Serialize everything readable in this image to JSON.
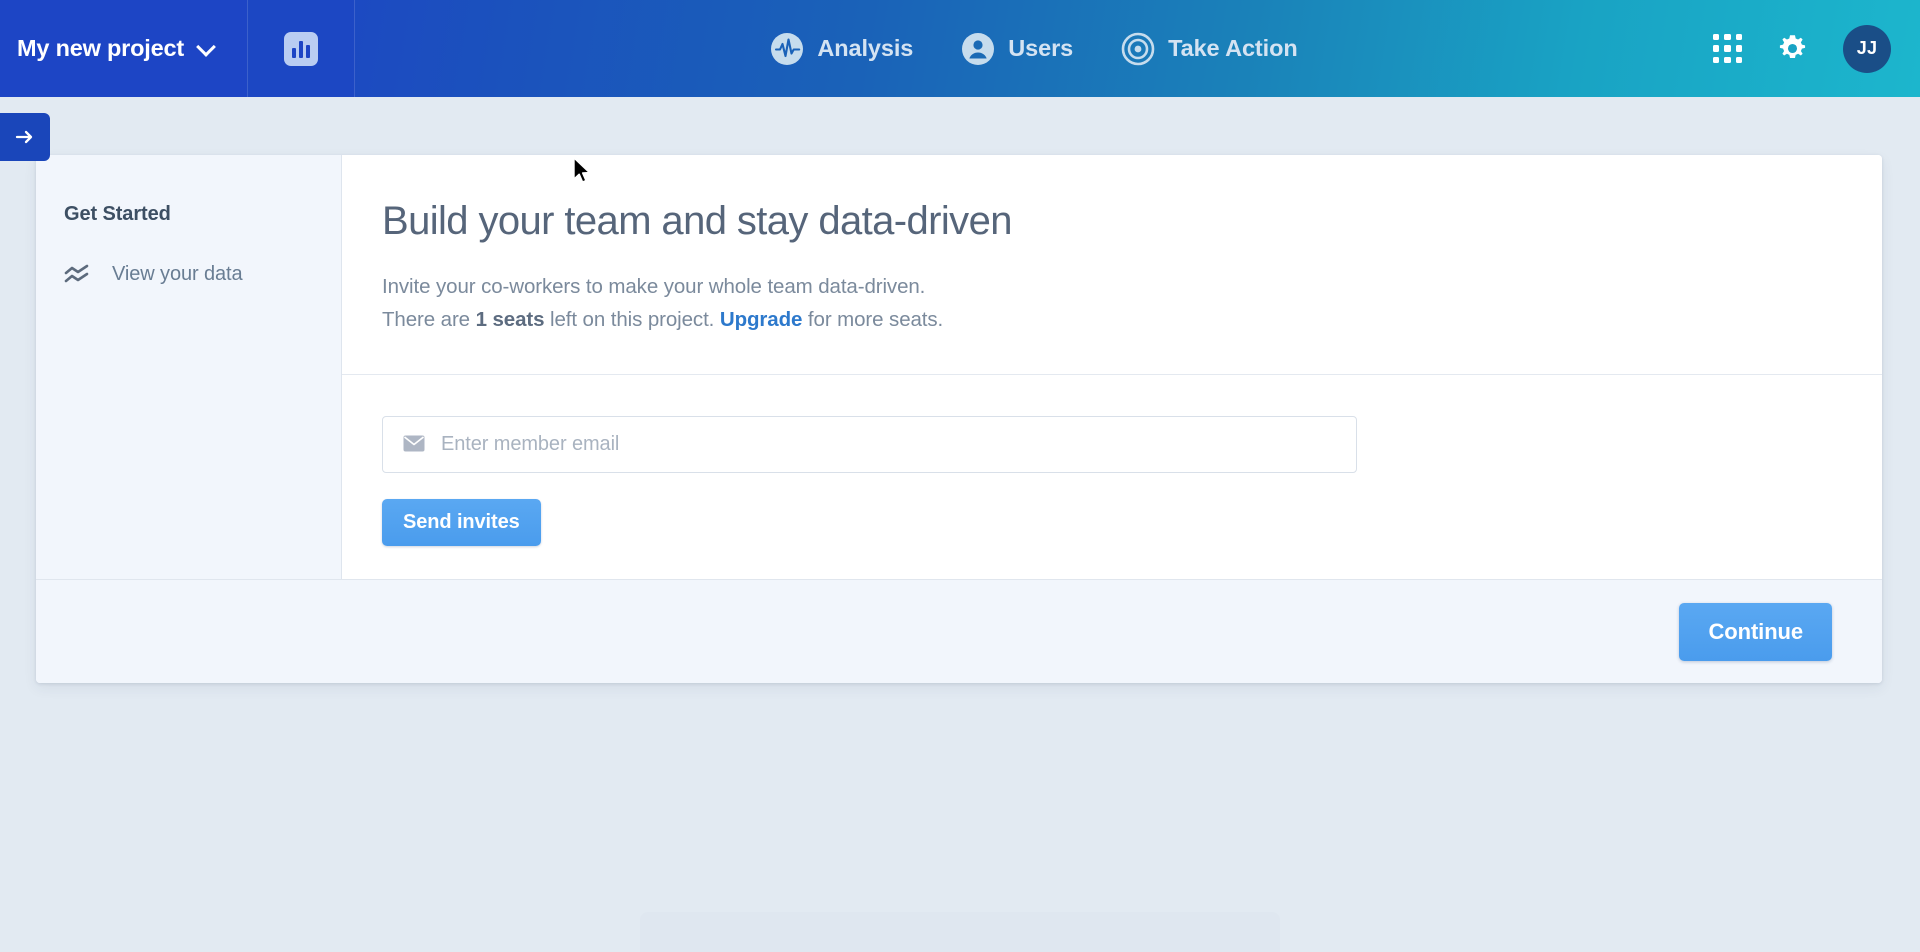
{
  "header": {
    "project_name": "My new project",
    "chevron_icon": "chevron-down-icon",
    "logo_icon": "bar-chart-logo-icon",
    "nav": [
      {
        "label": "Analysis",
        "icon": "pulse-circle-icon"
      },
      {
        "label": "Users",
        "icon": "user-circle-icon"
      },
      {
        "label": "Take Action",
        "icon": "target-bullseye-icon"
      }
    ],
    "apps_icon": "grid-apps-icon",
    "settings_icon": "gear-icon",
    "avatar_initials": "JJ"
  },
  "expand_tab": {
    "icon": "arrow-right-icon"
  },
  "sidebar": {
    "title": "Get Started",
    "items": [
      {
        "label": "View your data",
        "icon": "trend-lines-icon"
      }
    ]
  },
  "main": {
    "title": "Build your team and stay data-driven",
    "subtitle_line1": "Invite your co-workers to make your whole team data-driven.",
    "subtitle_prefix": "There are ",
    "seats_count": "1 seats",
    "subtitle_middle": " left on this project. ",
    "upgrade_link": "Upgrade",
    "subtitle_suffix": " for more seats.",
    "email_placeholder": "Enter member email",
    "email_value": "",
    "email_icon": "envelope-icon",
    "send_invites_label": "Send invites"
  },
  "footer": {
    "continue_label": "Continue"
  },
  "colors": {
    "header_start": "#1d45c5",
    "header_end": "#1cb6cd",
    "accent_blue": "#4a9ced",
    "link_blue": "#2d79cc",
    "page_bg": "#e2eaf2",
    "panel_bg": "#f2f6fc",
    "avatar_bg": "#1a4e87"
  }
}
